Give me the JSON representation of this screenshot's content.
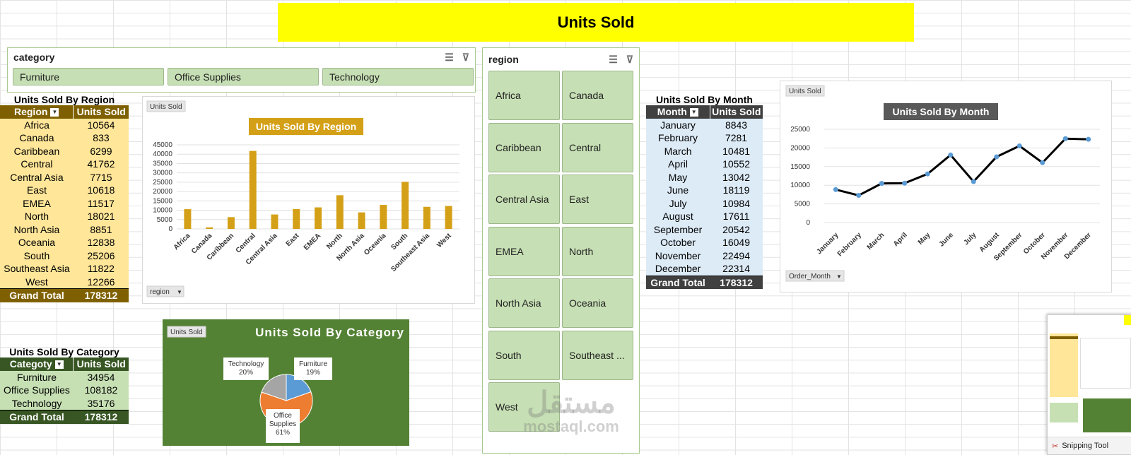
{
  "banner": {
    "title": "Units Sold"
  },
  "category_slicer": {
    "header": "category",
    "items": [
      "Furniture",
      "Office Supplies",
      "Technology"
    ]
  },
  "region_slicer": {
    "header": "region",
    "items": [
      "Africa",
      "Canada",
      "Caribbean",
      "Central",
      "Central Asia",
      "East",
      "EMEA",
      "North",
      "North Asia",
      "Oceania",
      "South",
      "Southeast ...",
      "West"
    ]
  },
  "region_table": {
    "title": "Units Sold By Region",
    "headers": [
      "Region",
      "Units Sold"
    ],
    "rows": [
      [
        "Africa",
        "10564"
      ],
      [
        "Canada",
        "833"
      ],
      [
        "Caribbean",
        "6299"
      ],
      [
        "Central",
        "41762"
      ],
      [
        "Central Asia",
        "7715"
      ],
      [
        "East",
        "10618"
      ],
      [
        "EMEA",
        "11517"
      ],
      [
        "North",
        "18021"
      ],
      [
        "North Asia",
        "8851"
      ],
      [
        "Oceania",
        "12838"
      ],
      [
        "South",
        "25206"
      ],
      [
        "Southeast Asia",
        "11822"
      ],
      [
        "West",
        "12266"
      ]
    ],
    "total": [
      "Grand Total",
      "178312"
    ]
  },
  "category_table": {
    "title": "Units Sold By Category",
    "headers": [
      "Categoty",
      "Units Sold"
    ],
    "rows": [
      [
        "Furniture",
        "34954"
      ],
      [
        "Office Supplies",
        "108182"
      ],
      [
        "Technology",
        "35176"
      ]
    ],
    "total": [
      "Grand Total",
      "178312"
    ]
  },
  "month_table": {
    "title": "Units Sold By Month",
    "headers": [
      "Month",
      "Units Sold"
    ],
    "rows": [
      [
        "January",
        "8843"
      ],
      [
        "February",
        "7281"
      ],
      [
        "March",
        "10481"
      ],
      [
        "April",
        "10552"
      ],
      [
        "May",
        "13042"
      ],
      [
        "June",
        "18119"
      ],
      [
        "July",
        "10984"
      ],
      [
        "August",
        "17611"
      ],
      [
        "September",
        "20542"
      ],
      [
        "October",
        "16049"
      ],
      [
        "November",
        "22494"
      ],
      [
        "December",
        "22314"
      ]
    ],
    "total": [
      "Grand Total",
      "178312"
    ]
  },
  "watermark": {
    "arabic": "مستقل",
    "latin": "mostaql.com"
  },
  "taskbar": {
    "snipping_tool": "Snipping Tool"
  },
  "colors": {
    "banner": "#ffff00",
    "bar": "#d4a017",
    "region_header": "#7f6000",
    "region_body": "#ffe699",
    "category_header": "#375623",
    "category_body": "#c6e0b4",
    "month_header": "#404040",
    "month_body": "#ddebf7",
    "line": "#000000",
    "marker": "#5b9bd5",
    "pie_chart_bg": "#548235",
    "pie_furniture": "#5b9bd5",
    "pie_office": "#ed7d31",
    "pie_technology": "#a5a5a5"
  },
  "chart_data": [
    {
      "type": "bar",
      "title": "Units Sold By Region",
      "tag": "Units Sold",
      "field_button": "region",
      "categories": [
        "Africa",
        "Canada",
        "Caribbean",
        "Central",
        "Central Asia",
        "East",
        "EMEA",
        "North",
        "North Asia",
        "Oceania",
        "South",
        "Southeast Asia",
        "West"
      ],
      "values": [
        10564,
        833,
        6299,
        41762,
        7715,
        10618,
        11517,
        18021,
        8851,
        12838,
        25206,
        11822,
        12266
      ],
      "ylim": [
        0,
        45000
      ],
      "yticks": [
        0,
        5000,
        10000,
        15000,
        20000,
        25000,
        30000,
        35000,
        40000,
        45000
      ],
      "grid": true,
      "legend": "none"
    },
    {
      "type": "line",
      "title": "Units Sold By Month",
      "tag": "Units Sold",
      "field_button": "Order_Month",
      "categories": [
        "January",
        "February",
        "March",
        "April",
        "May",
        "June",
        "July",
        "August",
        "September",
        "October",
        "November",
        "December"
      ],
      "values": [
        8843,
        7281,
        10481,
        10552,
        13042,
        18119,
        10984,
        17611,
        20542,
        16049,
        22494,
        22314
      ],
      "ylim": [
        0,
        25000
      ],
      "yticks": [
        0,
        5000,
        10000,
        15000,
        20000,
        25000
      ],
      "grid": true,
      "legend": "none"
    },
    {
      "type": "pie",
      "title": "Units Sold By Category",
      "tag": "Units Sold",
      "slices": [
        {
          "name": "Furniture",
          "value": 34954,
          "label": "19%"
        },
        {
          "name": "Office Supplies",
          "value": 108182,
          "label": "61%"
        },
        {
          "name": "Technology",
          "value": 35176,
          "label": "20%"
        }
      ],
      "legend": "none"
    }
  ]
}
